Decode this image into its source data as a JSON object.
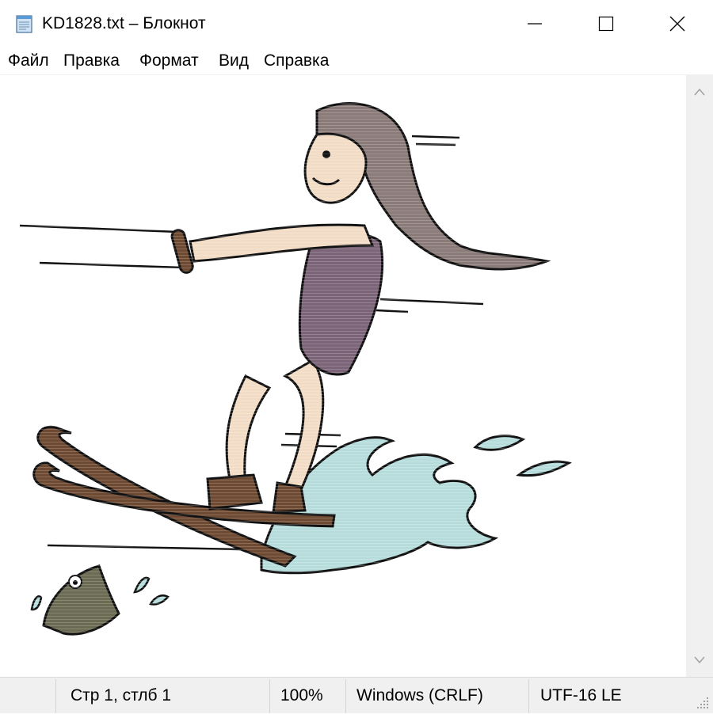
{
  "window": {
    "title": "KD1828.txt – Блокнот",
    "icons": {
      "app": "notepad-icon",
      "minimize": "minimize-icon",
      "maximize": "maximize-icon",
      "close": "close-icon"
    }
  },
  "menu": {
    "file": "Файл",
    "edit": "Правка",
    "format": "Формат",
    "view": "Вид",
    "help": "Справка"
  },
  "content": {
    "illustration": "water-skier-girl-and-fish-illustration"
  },
  "status": {
    "position": "Стр 1, стлб 1",
    "zoom": "100%",
    "line_endings": "Windows (CRLF)",
    "encoding": "UTF-16 LE"
  },
  "colors": {
    "hair": "#8a7a78",
    "skin": "#f3dcc6",
    "swimsuit": "#7b6478",
    "ski": "#6e4a32",
    "water": "#b7dcdc",
    "fish": "#6b6a52",
    "outline": "#111111",
    "chrome": "#f0f0f0"
  }
}
